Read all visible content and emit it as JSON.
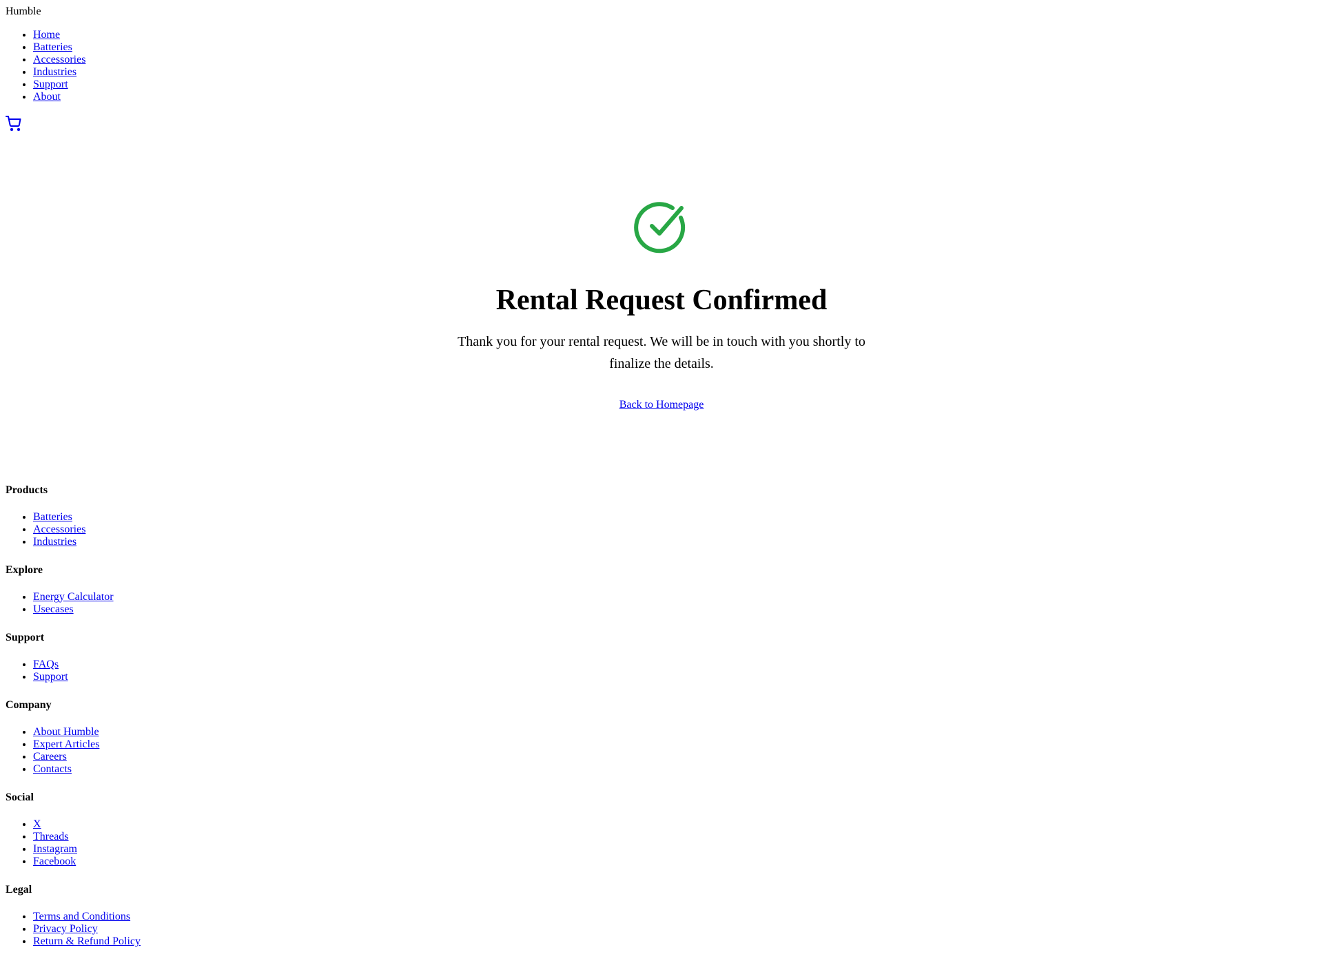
{
  "header": {
    "brand": "Humble",
    "nav": [
      "Home",
      "Batteries",
      "Accessories",
      "Industries",
      "Support",
      "About"
    ],
    "cart_icon": "cart-icon"
  },
  "main": {
    "status_icon": "check-circle-icon",
    "title": "Rental Request Confirmed",
    "message": "Thank you for your rental request. We will be in touch with you shortly to finalize the details.",
    "back_link": "Back to Homepage",
    "accent_color": "#28a745"
  },
  "footer": {
    "sections": [
      {
        "heading": "Products",
        "links": [
          "Batteries",
          "Accessories",
          "Industries"
        ]
      },
      {
        "heading": "Explore",
        "links": [
          "Energy Calculator",
          "Usecases"
        ]
      },
      {
        "heading": "Support",
        "links": [
          "FAQs",
          "Support"
        ]
      },
      {
        "heading": "Company",
        "links": [
          "About Humble",
          "Expert Articles",
          "Careers",
          "Contacts"
        ]
      },
      {
        "heading": "Social",
        "links": [
          "X",
          "Threads",
          "Instagram",
          "Facebook"
        ]
      },
      {
        "heading": "Legal",
        "links": [
          "Terms and Conditions",
          "Privacy Policy",
          "Return & Refund Policy"
        ]
      }
    ]
  }
}
